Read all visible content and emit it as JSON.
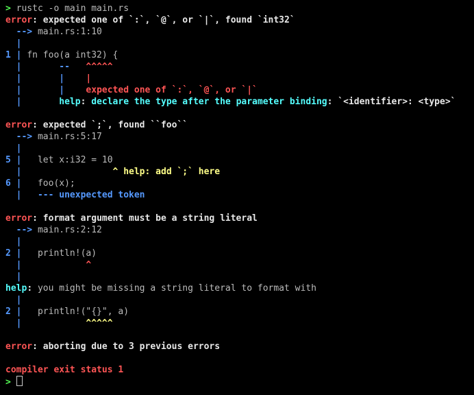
{
  "command": "rustc -o main main.rs",
  "err1": {
    "label": "error",
    "msg": "expected one of `:`, `@`, or `|`, found `int32`",
    "arrow": "-->",
    "loc": "main.rs:1:10",
    "ln": "1",
    "code": "fn foo(a int32) {",
    "carets": "--       ^^^^^",
    "help_label": "help",
    "help_expected": "expected one of `:`, `@`, or `|`",
    "help_decl": "declare the type after the parameter binding",
    "help_example": "`<identifier>: <type>`"
  },
  "err2": {
    "label": "error",
    "msg": "expected `;`, found ``foo``",
    "arrow": "-->",
    "loc": "main.rs:5:17",
    "ln5": "5",
    "code5": "let x:i32 = 10",
    "help5": "^ help: add `;` here",
    "ln6": "6",
    "code6": "foo(x);",
    "note6": "--- unexpected token"
  },
  "err3": {
    "label": "error",
    "msg": "format argument must be a string literal",
    "arrow": "-->",
    "loc": "main.rs:2:12",
    "ln": "2",
    "code": "println!(a)",
    "caret": "^",
    "help_label": "help",
    "help_msg": "you might be missing a string literal to format with",
    "fix_code": "println!(\"{}\", a)",
    "fix_carets": "^^^^^"
  },
  "abort": {
    "label": "error",
    "msg": "aborting due to 3 previous errors"
  },
  "status": "compiler exit status 1",
  "prompt": ">"
}
